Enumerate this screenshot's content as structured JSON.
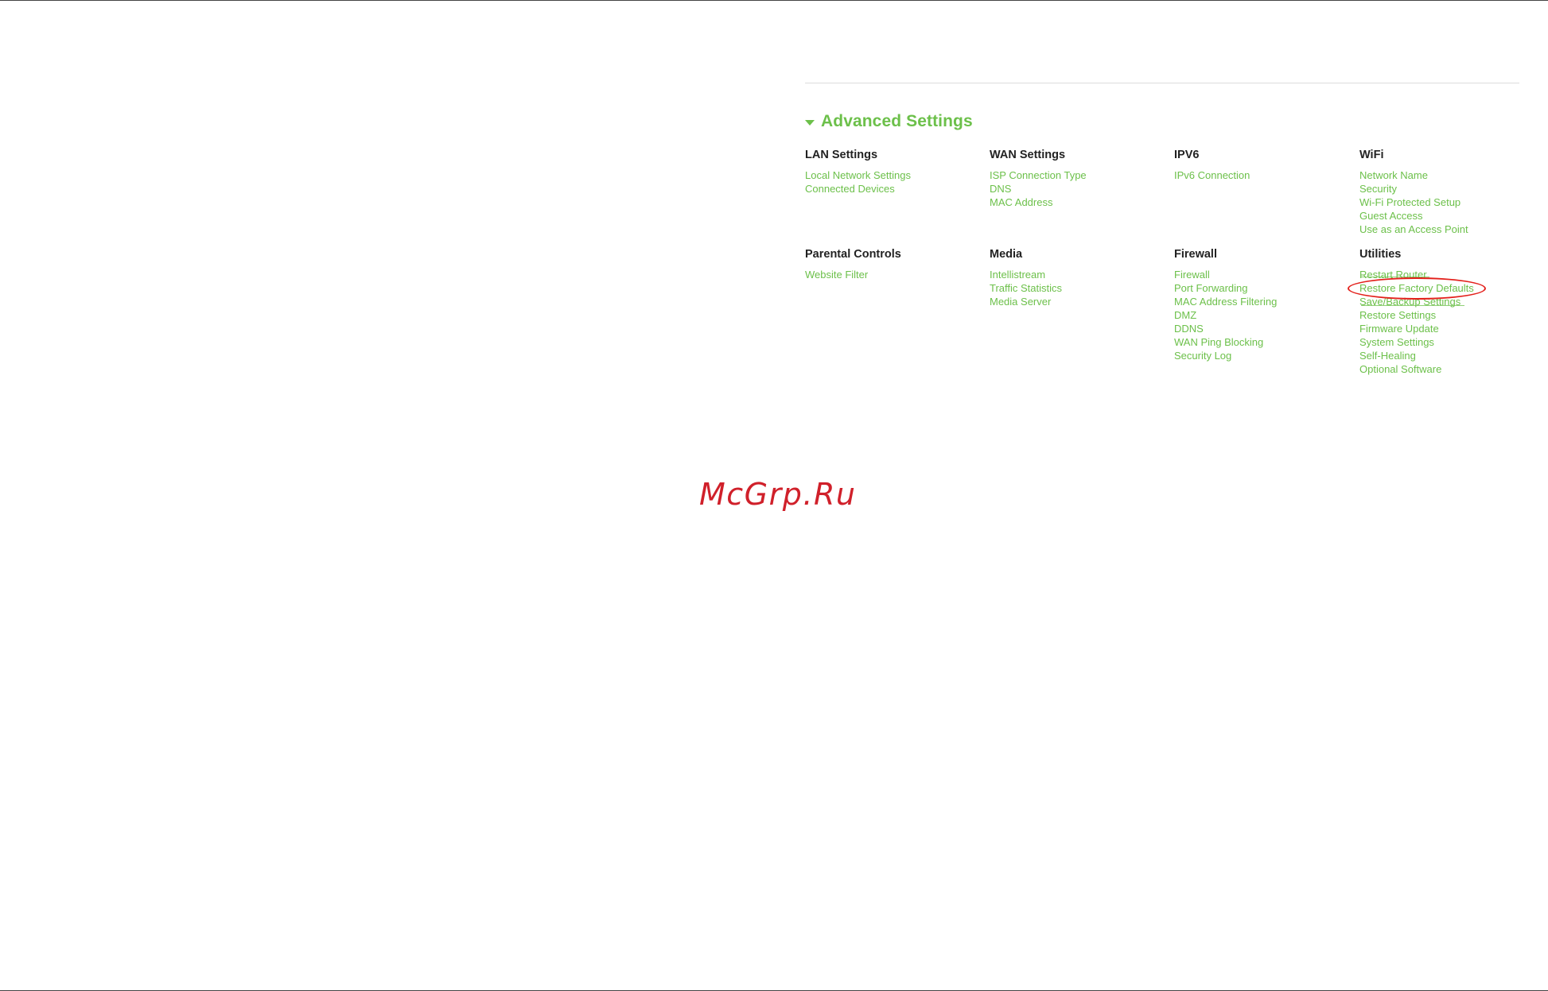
{
  "advanced_settings": {
    "title": "Advanced Settings",
    "accent_color": "#6cc04a",
    "groups": [
      {
        "title": "LAN Settings",
        "links": [
          "Local Network Settings",
          "Connected Devices"
        ]
      },
      {
        "title": "WAN Settings",
        "links": [
          "ISP Connection Type",
          "DNS",
          "MAC Address"
        ]
      },
      {
        "title": "IPV6",
        "links": [
          "IPv6 Connection"
        ]
      },
      {
        "title": "WiFi",
        "links": [
          "Network Name",
          "Security",
          "Wi-Fi Protected Setup",
          "Guest Access",
          "Use as an Access Point"
        ]
      },
      {
        "title": "Parental Controls",
        "links": [
          "Website Filter"
        ]
      },
      {
        "title": "Media",
        "links": [
          "Intellistream",
          "Traffic Statistics",
          "Media Server"
        ]
      },
      {
        "title": "Firewall",
        "links": [
          "Firewall",
          "Port Forwarding",
          "MAC Address Filtering",
          "DMZ",
          "DDNS",
          "WAN Ping Blocking",
          "Security Log"
        ]
      },
      {
        "title": "Utilities",
        "links": [
          "Restart Router",
          "Restore Factory Defaults",
          "Save/Backup Settings",
          "Restore Settings",
          "Firmware Update",
          "System Settings",
          "Self-Healing",
          "Optional Software"
        ]
      }
    ]
  },
  "annotation": {
    "highlighted_item": "Restore Factory Defaults",
    "color": "#e3201b"
  },
  "watermark": {
    "text": "McGrp.Ru",
    "color": "#d0202a"
  }
}
